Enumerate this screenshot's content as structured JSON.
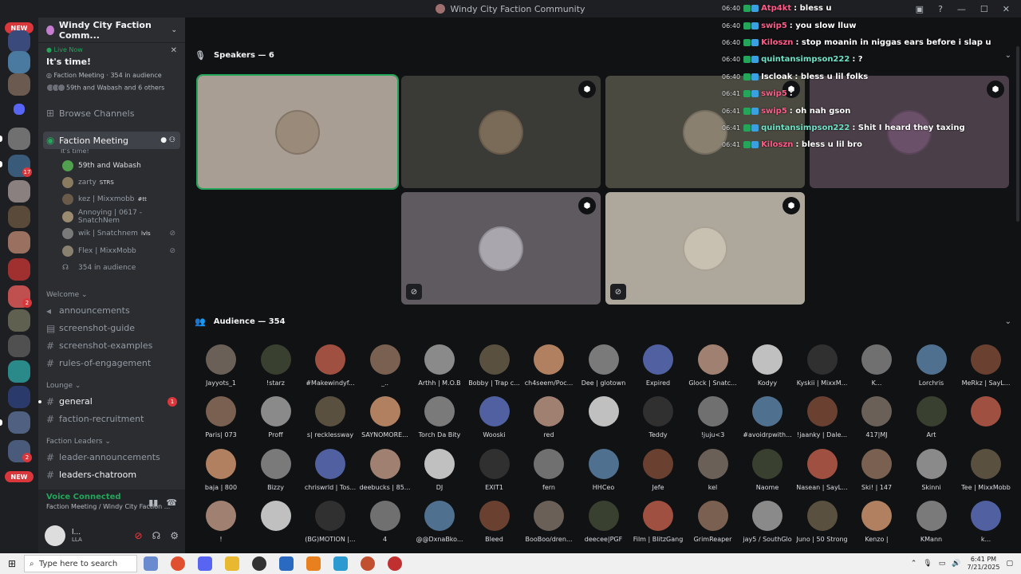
{
  "window": {
    "title": "Windy City Faction Community"
  },
  "rail": {
    "badges": {
      "top_new": "NEW",
      "bottom_new": "NEW",
      "b1": "17",
      "b2": "2",
      "b3": "2",
      "b4": "2"
    }
  },
  "sidebar": {
    "server_name": "Windy City Faction Comm...",
    "live": {
      "label": "Live Now",
      "title": "It's time!",
      "meta": "Faction Meeting · 354 in audience",
      "speakers": "59th and Wabash and 6 others"
    },
    "browse": "Browse Channels",
    "stage": {
      "name": "Faction Meeting",
      "topic": "It's time!"
    },
    "members": [
      {
        "name": "59th and Wabash",
        "tag": ""
      },
      {
        "name": "zarty",
        "tag": "STRS"
      },
      {
        "name": "kez | Mixxmobb",
        "tag": "#tt"
      },
      {
        "name": "Annoying | 0617 - SnatchNem",
        "tag": ""
      },
      {
        "name": "wik | Snatchnem",
        "tag": "lvls"
      },
      {
        "name": "Flex | MixxMobb",
        "tag": ""
      }
    ],
    "audience_count": "354 in audience",
    "categories": [
      {
        "name": "Welcome",
        "channels": [
          "announcements",
          "screenshot-guide",
          "screenshot-examples",
          "rules-of-engagement"
        ]
      },
      {
        "name": "Lounge",
        "channels": [
          "general",
          "faction-recruitment"
        ]
      },
      {
        "name": "Faction Leaders",
        "channels": [
          "leader-announcements",
          "leaders-chatroom"
        ]
      }
    ],
    "general_unread": "1",
    "voice": {
      "status": "Voice Connected",
      "channel": "Faction Meeting / Windy City Faction ..."
    },
    "user": {
      "name": "l...",
      "status": "LLA"
    }
  },
  "main": {
    "speakers_header": "Speakers — 6",
    "audience_header": "Audience — 354",
    "audience": [
      [
        "Jayyots_1",
        "!starz",
        "#Makewindyf...",
        "_..",
        "Arthh | M.O.B",
        "Bobby | Trap c...",
        "ch4seem/Poc...",
        "Dee | glotown",
        "Expired",
        "Glock | Snatc...",
        "Kodyy",
        "Kyskii | MixxM...",
        "K...",
        "Lorchris",
        "MeRkz | SayL..."
      ],
      [
        "Paris| 073",
        "Proff",
        "s| recklessway",
        "SAYNOMORE...",
        "Torch Da Bity",
        "Wooski",
        "red",
        "",
        "Teddy",
        "!juju<3",
        "#avoidrpwith...",
        "!jaanky | Dale...",
        "417|MJ",
        "Art",
        ""
      ],
      [
        "baja | 800",
        "Bizzy",
        "chriswrld | Tos...",
        "deebucks | 85...",
        "DJ",
        "EXIT1",
        "fern",
        "HHCeo",
        "Jefe",
        "kel",
        "Naome",
        "Nasean | SayL...",
        "Ski! | 147",
        "Skinni",
        "Tee | MixxMobb"
      ],
      [
        "!",
        "",
        "(BG)MOTION |...",
        "4",
        "@@DxnaBko...",
        "Bleed",
        "BooBoo/dren...",
        "deecee|PGF",
        "Film | BlitzGang",
        "GrimReaper",
        "jay5 / SouthGlo",
        "Juno | 50 Strong",
        "Kenzo |",
        "KMann",
        "k..."
      ]
    ]
  },
  "chat": [
    {
      "time": "06:40",
      "user": "Atp4kt",
      "msg": "bless u",
      "color": "#ff5c8a"
    },
    {
      "time": "06:40",
      "user": "swip5",
      "msg": "you slow lluw",
      "color": "#ff5c8a"
    },
    {
      "time": "06:40",
      "user": "Kiloszn",
      "msg": "stop moanin in niggas ears before i slap u",
      "color": "#ff5c8a"
    },
    {
      "time": "06:40",
      "user": "quintansimpson222",
      "msg": "?",
      "color": "#6fe3c7"
    },
    {
      "time": "06:40",
      "user": "Iscloak",
      "msg": "bless u lil folks",
      "color": "#ffffff"
    },
    {
      "time": "06:41",
      "user": "swip5",
      "msg": "",
      "color": "#ff5c8a"
    },
    {
      "time": "06:41",
      "user": "swip5",
      "msg": "oh nah gson",
      "color": "#ff5c8a"
    },
    {
      "time": "06:41",
      "user": "quintansimpson222",
      "msg": "Shit I heard they taxing",
      "color": "#6fe3c7"
    },
    {
      "time": "06:41",
      "user": "Kiloszn",
      "msg": "bless u lil bro",
      "color": "#ff5c8a"
    }
  ],
  "taskbar": {
    "search_placeholder": "Type here to search",
    "time": "6:41 PM",
    "date": "7/21/2025"
  }
}
